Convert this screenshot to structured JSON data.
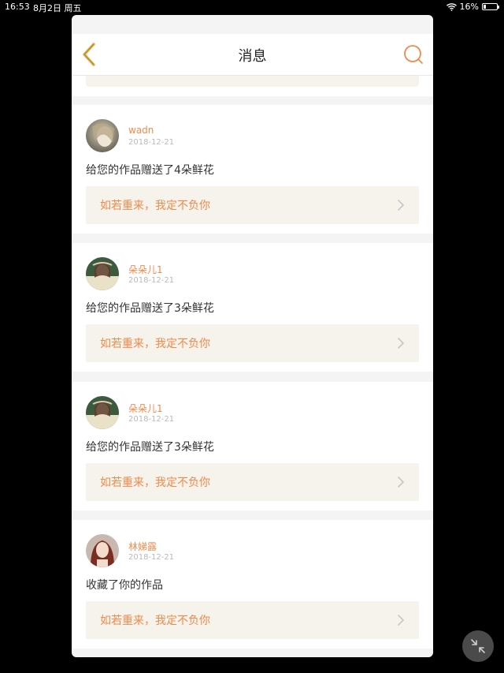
{
  "status_bar": {
    "time": "16:53",
    "date": "8月2日 周五",
    "battery_percent": "16%",
    "battery_level": 0.16
  },
  "nav": {
    "title": "消息"
  },
  "colors": {
    "accent": "#f08a4b",
    "back_arrow": "#e6b34a",
    "reply_bg": "#f5f3ec",
    "page_bg": "#f4f4f4"
  },
  "messages": [
    {
      "username": "wadn",
      "date": "2018-12-21",
      "text": "给您的作品赠送了4朵鲜花",
      "reply": "如若重来，我定不负你"
    },
    {
      "username": "朵朵儿1",
      "date": "2018-12-21",
      "text": "给您的作品赠送了3朵鲜花",
      "reply": "如若重来，我定不负你"
    },
    {
      "username": "朵朵儿1",
      "date": "2018-12-21",
      "text": "给您的作品赠送了3朵鲜花",
      "reply": "如若重来，我定不负你"
    },
    {
      "username": "林娣露",
      "date": "2018-12-21",
      "text": "收藏了你的作品",
      "reply": "如若重来，我定不负你"
    }
  ],
  "icons": {
    "back": "chevron-left-icon",
    "search": "search-icon",
    "reply_chevron": "chevron-right-icon",
    "fab": "collapse-icon",
    "wifi": "wifi-icon",
    "battery": "battery-icon"
  }
}
